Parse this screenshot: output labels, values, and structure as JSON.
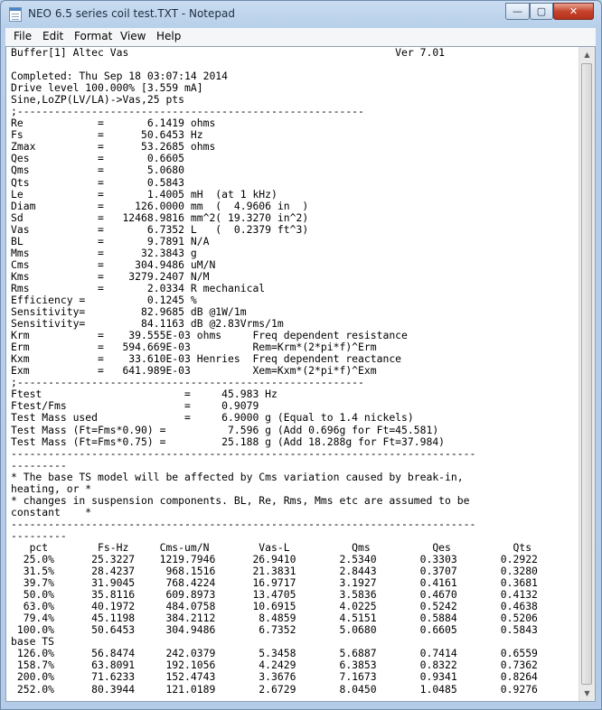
{
  "window": {
    "title": "NEO 6.5 series coil test.TXT - Notepad",
    "minimize_glyph": "—",
    "maximize_glyph": "▢",
    "close_glyph": "✕"
  },
  "menu": [
    "File",
    "Edit",
    "Format",
    "View",
    "Help"
  ],
  "document": {
    "lines": [
      "Buffer[1] Altec Vas                                           Ver 7.01",
      "",
      "Completed: Thu Sep 18 03:07:14 2014",
      "Drive level 100.000% [3.559 mA]",
      "Sine,LoZP(LV/LA)->Vas,25 pts",
      ";--------------------------------------------------------",
      "Re            =       6.1419 ohms",
      "Fs            =      50.6453 Hz",
      "Zmax          =      53.2685 ohms",
      "Qes           =       0.6605",
      "Qms           =       5.0680",
      "Qts           =       0.5843",
      "Le            =       1.4005 mH  (at 1 kHz)",
      "Diam          =     126.0000 mm  (  4.9606 in  )",
      "Sd            =   12468.9816 mm^2( 19.3270 in^2)",
      "Vas           =       6.7352 L   (  0.2379 ft^3)",
      "BL            =       9.7891 N/A",
      "Mms           =      32.3843 g",
      "Cms           =     304.9486 uM/N",
      "Kms           =    3279.2407 N/M",
      "Rms           =       2.0334 R mechanical",
      "Efficiency =          0.1245 %",
      "Sensitivity=         82.9685 dB @1W/1m",
      "Sensitivity=         84.1163 dB @2.83Vrms/1m",
      "Krm           =    39.555E-03 ohms     Freq dependent resistance",
      "Erm           =   594.669E-03          Rem=Krm*(2*pi*f)^Erm",
      "Kxm           =    33.610E-03 Henries  Freq dependent reactance",
      "Exm           =   641.989E-03          Xem=Kxm*(2*pi*f)^Exm",
      ";--------------------------------------------------------",
      "Ftest                       =     45.983 Hz",
      "Ftest/Fms                   =     0.9079",
      "Test Mass used              =     6.9000 g (Equal to 1.4 nickels)",
      "Test Mass (Ft=Fms*0.90) =          7.596 g (Add 0.696g for Ft=45.581)",
      "Test Mass (Ft=Fms*0.75) =         25.188 g (Add 18.288g for Ft=37.984)",
      "---------------------------------------------------------------------------",
      "---------",
      "* The base TS model will be affected by Cms variation caused by break-in,",
      "heating, or *",
      "* changes in suspension components. BL, Re, Rms, Mms etc are assumed to be",
      "constant    *",
      "---------------------------------------------------------------------------",
      "---------",
      "   pct        Fs-Hz     Cms-um/N        Vas-L          Qms          Qes          Qts",
      "  25.0%      25.3227    1219.7946      26.9410       2.5340       0.3303       0.2922",
      "  31.5%      28.4237     968.1516      21.3831       2.8443       0.3707       0.3280",
      "  39.7%      31.9045     768.4224      16.9717       3.1927       0.4161       0.3681",
      "  50.0%      35.8116     609.8973      13.4705       3.5836       0.4670       0.4132",
      "  63.0%      40.1972     484.0758      10.6915       4.0225       0.5242       0.4638",
      "  79.4%      45.1198     384.2112       8.4859       4.5151       0.5884       0.5206",
      " 100.0%      50.6453     304.9486       6.7352       5.0680       0.6605       0.5843       <-",
      "base TS",
      " 126.0%      56.8474     242.0379       5.3458       5.6887       0.7414       0.6559",
      " 158.7%      63.8091     192.1056       4.2429       6.3853       0.8322       0.7362",
      " 200.0%      71.6233     152.4743       3.3676       7.1673       0.9341       0.8264",
      " 252.0%      80.3944     121.0189       2.6729       8.0450       1.0485       0.9276"
    ]
  }
}
